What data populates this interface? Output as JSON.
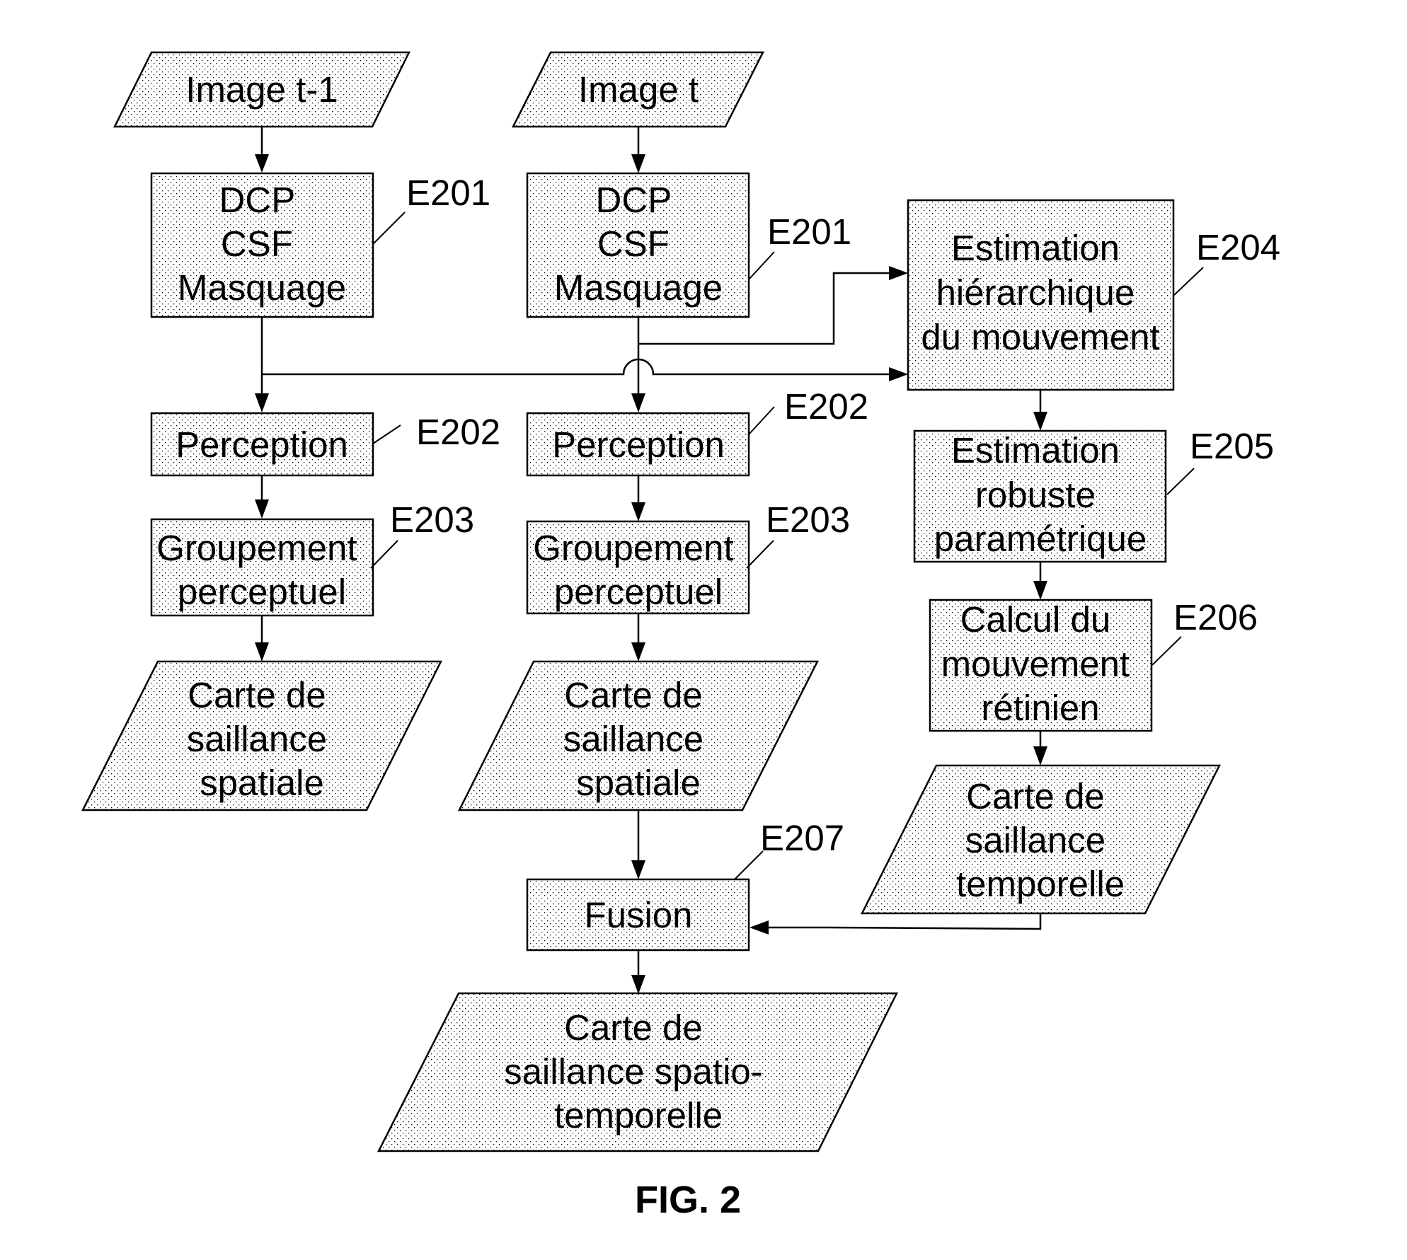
{
  "figure": {
    "caption": "FIG. 2",
    "colors": {
      "stroke": "#000000",
      "fill_pattern": "dotted-gray",
      "background": "#ffffff"
    }
  },
  "nodes": {
    "image_prev": {
      "lines": [
        "Image t-1"
      ],
      "shape": "parallelogram"
    },
    "image_curr": {
      "lines": [
        "Image t"
      ],
      "shape": "parallelogram"
    },
    "dcp_left": {
      "lines": [
        "DCP",
        "CSF",
        "Masquage"
      ],
      "ref": "E201",
      "shape": "process"
    },
    "dcp_mid": {
      "lines": [
        "DCP",
        "CSF",
        "Masquage"
      ],
      "ref": "E201",
      "shape": "process"
    },
    "perception_left": {
      "lines": [
        "Perception"
      ],
      "ref": "E202",
      "shape": "process"
    },
    "perception_mid": {
      "lines": [
        "Perception"
      ],
      "ref": "E202",
      "shape": "process"
    },
    "grouping_left": {
      "lines": [
        "Groupement",
        "perceptuel"
      ],
      "ref": "E203",
      "shape": "process"
    },
    "grouping_mid": {
      "lines": [
        "Groupement",
        "perceptuel"
      ],
      "ref": "E203",
      "shape": "process"
    },
    "spatial_map_left": {
      "lines": [
        "Carte de",
        "saillance",
        "spatiale"
      ],
      "shape": "parallelogram"
    },
    "spatial_map_mid": {
      "lines": [
        "Carte de",
        "saillance",
        "spatiale"
      ],
      "shape": "parallelogram"
    },
    "motion_hier": {
      "lines": [
        "Estimation",
        "hiérarchique",
        "du mouvement"
      ],
      "ref": "E204",
      "shape": "process"
    },
    "motion_robust": {
      "lines": [
        "Estimation",
        "robuste",
        "paramétrique"
      ],
      "ref": "E205",
      "shape": "process"
    },
    "retinal_motion": {
      "lines": [
        "Calcul du",
        "mouvement",
        "rétinien"
      ],
      "ref": "E206",
      "shape": "process"
    },
    "temporal_map": {
      "lines": [
        "Carte de",
        "saillance",
        "temporelle"
      ],
      "shape": "parallelogram"
    },
    "fusion": {
      "lines": [
        "Fusion"
      ],
      "ref": "E207",
      "shape": "process"
    },
    "spatiotemporal_map": {
      "lines": [
        "Carte de",
        "saillance spatio-",
        "temporelle"
      ],
      "shape": "parallelogram"
    }
  },
  "edges": [
    [
      "image_prev",
      "dcp_left"
    ],
    [
      "image_curr",
      "dcp_mid"
    ],
    [
      "dcp_left",
      "perception_left"
    ],
    [
      "dcp_left",
      "motion_hier"
    ],
    [
      "dcp_mid",
      "perception_mid"
    ],
    [
      "dcp_mid",
      "motion_hier"
    ],
    [
      "perception_left",
      "grouping_left"
    ],
    [
      "perception_mid",
      "grouping_mid"
    ],
    [
      "grouping_left",
      "spatial_map_left"
    ],
    [
      "grouping_mid",
      "spatial_map_mid"
    ],
    [
      "spatial_map_mid",
      "fusion"
    ],
    [
      "motion_hier",
      "motion_robust"
    ],
    [
      "motion_robust",
      "retinal_motion"
    ],
    [
      "retinal_motion",
      "temporal_map"
    ],
    [
      "temporal_map",
      "fusion"
    ],
    [
      "fusion",
      "spatiotemporal_map"
    ]
  ]
}
